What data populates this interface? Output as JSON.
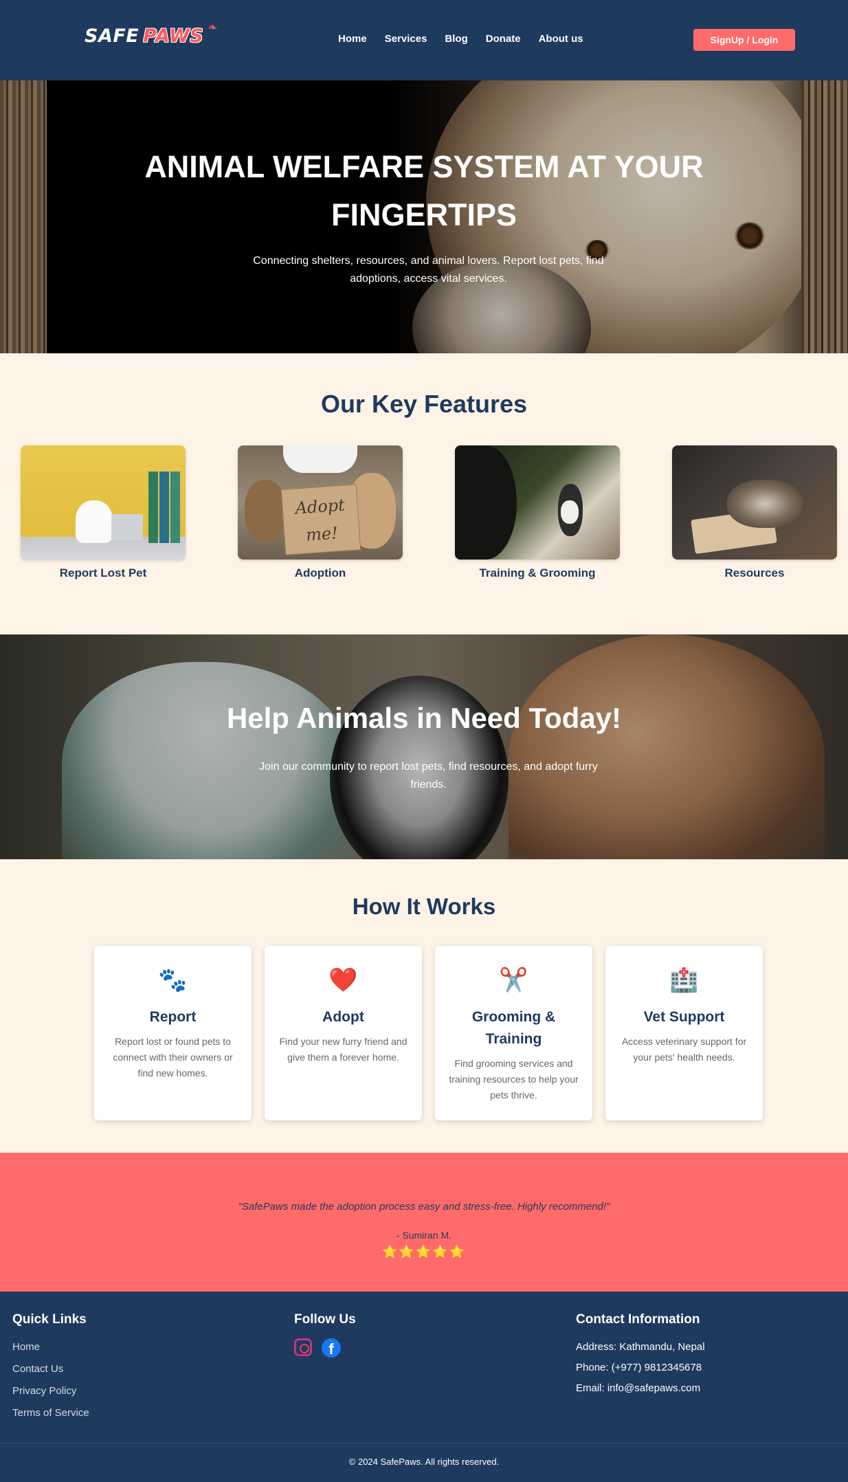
{
  "brand": {
    "word1": "SAFE",
    "word2": "PAWS",
    "paw_icon": "paw-icon"
  },
  "nav": {
    "items": [
      {
        "label": "Home"
      },
      {
        "label": "Services"
      },
      {
        "label": "Blog"
      },
      {
        "label": "Donate"
      },
      {
        "label": "About us"
      }
    ],
    "cta": "SignUp / Login"
  },
  "hero": {
    "title_line1": "ANIMAL WELFARE SYSTEM AT YOUR",
    "title_line2": "FINGERTIPS",
    "subtitle": "Connecting shelters, resources, and animal lovers. Report lost pets, find adoptions, access vital services."
  },
  "features": {
    "title": "Our Key Features",
    "items": [
      {
        "label": "Report Lost Pet"
      },
      {
        "label": "Adoption"
      },
      {
        "label": "Training & Grooming"
      },
      {
        "label": "Resources"
      }
    ]
  },
  "help": {
    "title": "Help Animals in Need Today!",
    "subtitle": "Join our community to report lost pets, find resources, and adopt furry friends."
  },
  "how": {
    "title": "How It Works",
    "cards": [
      {
        "icon": "🐾",
        "icon_name": "paw-prints-icon",
        "title": "Report",
        "text": "Report lost or found pets to connect with their owners or find new homes."
      },
      {
        "icon": "❤️",
        "icon_name": "heart-icon",
        "title": "Adopt",
        "text": "Find your new furry friend and give them a forever home."
      },
      {
        "icon": "✂️",
        "icon_name": "scissors-icon",
        "title": "Grooming & Training",
        "text": "Find grooming services and training resources to help your pets thrive."
      },
      {
        "icon": "🏥",
        "icon_name": "hospital-icon",
        "title": "Vet Support",
        "text": "Access veterinary support for your pets' health needs."
      }
    ]
  },
  "testimonial": {
    "quote": "“SafePaws made the adoption process easy and stress-free. Highly recommend!”",
    "author": "- Sumiran M.",
    "stars": "⭐⭐⭐⭐⭐",
    "rating": 5
  },
  "footer": {
    "quick_links_title": "Quick Links",
    "quick_links": [
      {
        "label": "Home"
      },
      {
        "label": "Contact Us"
      },
      {
        "label": "Privacy Policy"
      },
      {
        "label": "Terms of Service"
      }
    ],
    "follow_title": "Follow Us",
    "contact_title": "Contact Information",
    "address": "Address: Kathmandu, Nepal",
    "phone": "Phone: (+977) 9812345678",
    "email": "Email: info@safepaws.com",
    "copyright": "© 2024 SafePaws. All rights reserved."
  },
  "colors": {
    "navy": "#1e3a5f",
    "coral": "#ff6b6b",
    "cream": "#fdf3e6"
  }
}
